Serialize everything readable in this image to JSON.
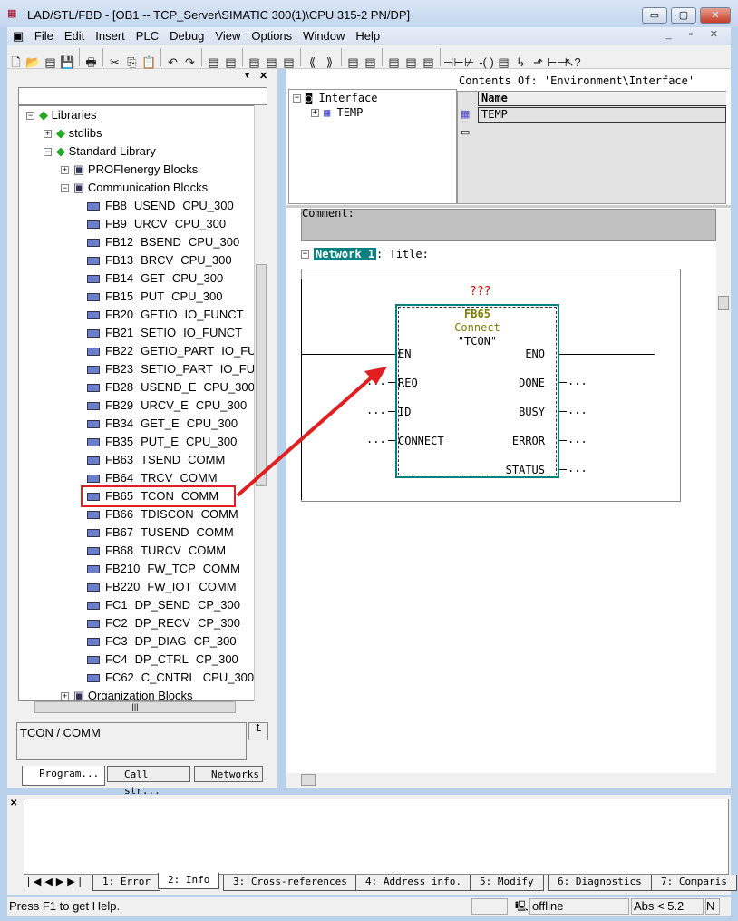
{
  "window": {
    "title": "LAD/STL/FBD  - [OB1 -- TCP_Server\\SIMATIC 300(1)\\CPU 315-2 PN/DP]",
    "minimize": "▭",
    "maximize": "▢",
    "close": "✕"
  },
  "menu": [
    "File",
    "Edit",
    "Insert",
    "PLC",
    "Debug",
    "View",
    "Options",
    "Window",
    "Help"
  ],
  "toolbar_icons": [
    "new-icon",
    "open-icon",
    "accessible-nodes-icon",
    "save-icon",
    "print-icon",
    "cut-icon",
    "copy-icon",
    "paste-icon",
    "undo-icon",
    "redo-icon",
    "download-icon",
    "monitor-icon",
    "overview-icon",
    "network-icon",
    "glasses-icon",
    "prev-icon",
    "next-icon",
    "program-elements-icon",
    "details-icon",
    "ladder-icon",
    "box-icon",
    "ladder2-icon",
    "contact-no-icon",
    "contact-nc-icon",
    "coil-icon",
    "box2-icon",
    "branch-open-icon",
    "branch-close-icon",
    "connect-icon",
    "help-icon"
  ],
  "tree": [
    {
      "level": 0,
      "exp": "⊟",
      "label": "Libraries"
    },
    {
      "level": 1,
      "exp": "⊞",
      "label": "stdlibs"
    },
    {
      "level": 1,
      "exp": "⊟",
      "label": "Standard Library"
    },
    {
      "level": 2,
      "exp": "⊞",
      "label": "PROFIenergy Blocks"
    },
    {
      "level": 2,
      "exp": "⊟",
      "label": "Communication Blocks"
    },
    {
      "level": 3,
      "id": "FB8",
      "name": "USEND",
      "family": "CPU_300"
    },
    {
      "level": 3,
      "id": "FB9",
      "name": "URCV",
      "family": "CPU_300"
    },
    {
      "level": 3,
      "id": "FB12",
      "name": "BSEND",
      "family": "CPU_300"
    },
    {
      "level": 3,
      "id": "FB13",
      "name": "BRCV",
      "family": "CPU_300"
    },
    {
      "level": 3,
      "id": "FB14",
      "name": "GET",
      "family": "CPU_300"
    },
    {
      "level": 3,
      "id": "FB15",
      "name": "PUT",
      "family": "CPU_300"
    },
    {
      "level": 3,
      "id": "FB20",
      "name": "GETIO",
      "family": "IO_FUNCT"
    },
    {
      "level": 3,
      "id": "FB21",
      "name": "SETIO",
      "family": "IO_FUNCT"
    },
    {
      "level": 3,
      "id": "FB22",
      "name": "GETIO_PART",
      "family": "IO_FUN"
    },
    {
      "level": 3,
      "id": "FB23",
      "name": "SETIO_PART",
      "family": "IO_FUN"
    },
    {
      "level": 3,
      "id": "FB28",
      "name": "USEND_E",
      "family": "CPU_300"
    },
    {
      "level": 3,
      "id": "FB29",
      "name": "URCV_E",
      "family": "CPU_300"
    },
    {
      "level": 3,
      "id": "FB34",
      "name": "GET_E",
      "family": "CPU_300"
    },
    {
      "level": 3,
      "id": "FB35",
      "name": "PUT_E",
      "family": "CPU_300"
    },
    {
      "level": 3,
      "id": "FB63",
      "name": "TSEND",
      "family": "COMM"
    },
    {
      "level": 3,
      "id": "FB64",
      "name": "TRCV",
      "family": "COMM"
    },
    {
      "level": 3,
      "id": "FB65",
      "name": "TCON",
      "family": "COMM",
      "highlighted": true
    },
    {
      "level": 3,
      "id": "FB66",
      "name": "TDISCON",
      "family": "COMM"
    },
    {
      "level": 3,
      "id": "FB67",
      "name": "TUSEND",
      "family": "COMM"
    },
    {
      "level": 3,
      "id": "FB68",
      "name": "TURCV",
      "family": "COMM"
    },
    {
      "level": 3,
      "id": "FB210",
      "name": "FW_TCP",
      "family": "COMM"
    },
    {
      "level": 3,
      "id": "FB220",
      "name": "FW_IOT",
      "family": "COMM"
    },
    {
      "level": 3,
      "id": "FC1",
      "name": "DP_SEND",
      "family": "CP_300"
    },
    {
      "level": 3,
      "id": "FC2",
      "name": "DP_RECV",
      "family": "CP_300"
    },
    {
      "level": 3,
      "id": "FC3",
      "name": "DP_DIAG",
      "family": "CP_300"
    },
    {
      "level": 3,
      "id": "FC4",
      "name": "DP_CTRL",
      "family": "CP_300"
    },
    {
      "level": 3,
      "id": "FC62",
      "name": "C_CNTRL",
      "family": "CPU_300"
    },
    {
      "level": 2,
      "exp": "⊞",
      "label": "Organization Blocks"
    }
  ],
  "info_box": "TCON / COMM",
  "left_tabs": [
    "Program...",
    "Call str...",
    "Networks"
  ],
  "interface": {
    "root": "Interface",
    "child": "TEMP",
    "contents_header": "Contents Of: 'Environment\\Interface'",
    "column": "Name",
    "row": "TEMP"
  },
  "editor": {
    "comment_label": "Comment:",
    "network_label": "Network 1",
    "network_title": ": Title:",
    "block": {
      "instance": "???",
      "number": "FB65",
      "comment": "Connect",
      "symbol": "\"TCON\"",
      "inputs": [
        "EN",
        "REQ",
        "ID",
        "CONNECT"
      ],
      "outputs": [
        "ENO",
        "DONE",
        "BUSY",
        "ERROR",
        "STATUS"
      ],
      "placeholder": "..."
    }
  },
  "bottom_tabs": [
    "1: Error",
    "2: Info",
    "3: Cross-references",
    "4: Address info.",
    "5: Modify",
    "6: Diagnostics",
    "7: Comparis"
  ],
  "status": {
    "help": "Press F1 to get Help.",
    "mode": "offline",
    "abs": "Abs < 5.2",
    "extra": "N"
  },
  "colors": {
    "block_border": "#0a8080",
    "network_label_bg": "#0a8080",
    "highlight": "#e02020",
    "block_title": "#808000"
  }
}
